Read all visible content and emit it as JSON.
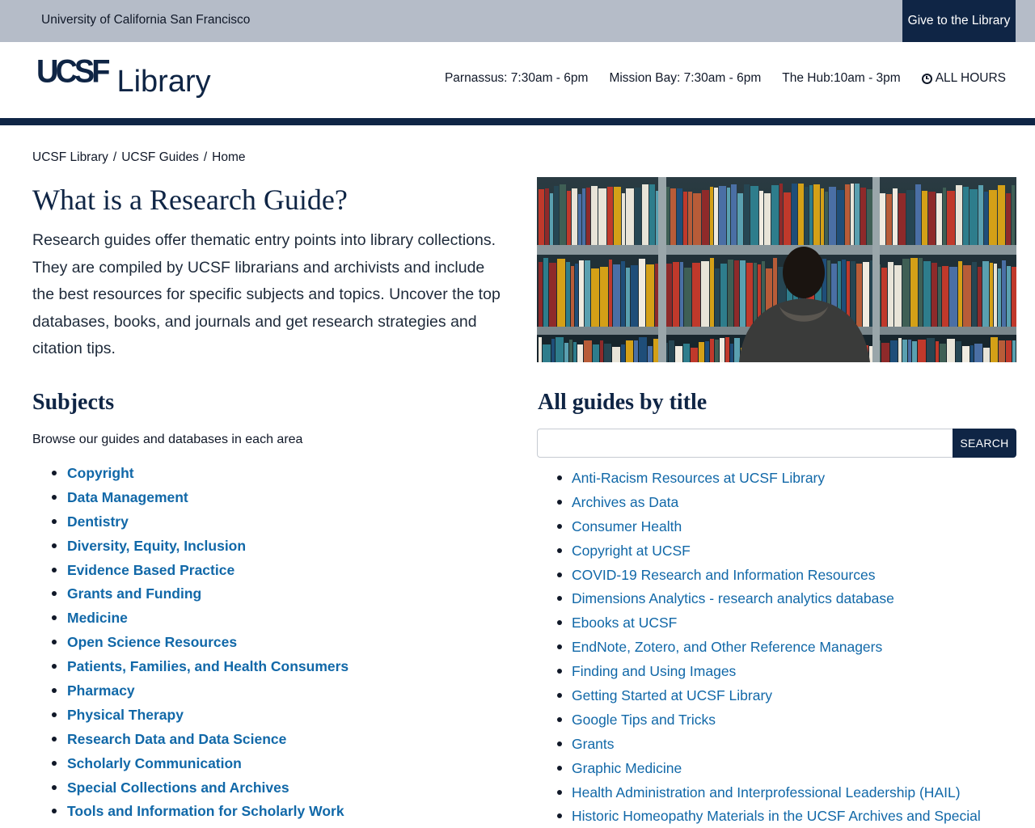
{
  "topbar": {
    "university": "University of California San Francisco",
    "give_label": "Give to the Library"
  },
  "header": {
    "logo_mark": "UCSF",
    "logo_word": "Library",
    "hours": [
      {
        "label": "Parnassus: 7:30am - 6pm"
      },
      {
        "label": "Mission Bay: 7:30am - 6pm"
      },
      {
        "label": "The Hub:10am - 3pm"
      }
    ],
    "all_hours_label": "ALL HOURS"
  },
  "breadcrumb": {
    "items": [
      "UCSF Library",
      "UCSF Guides",
      "Home"
    ],
    "separator": "/"
  },
  "intro": {
    "title": "What is a Research Guide?",
    "text": "Research guides offer thematic entry points into library collections. They are compiled by UCSF librarians and archivists and include the best resources for specific subjects and topics. Uncover the top databases, books, and journals and get research strategies and citation tips."
  },
  "subjects": {
    "title": "Subjects",
    "description": "Browse our guides and databases in each area",
    "items": [
      "Copyright",
      "Data Management",
      "Dentistry",
      "Diversity, Equity, Inclusion",
      "Evidence Based Practice",
      "Grants and Funding",
      "Medicine",
      "Open Science Resources",
      "Patients, Families, and Health Consumers",
      "Pharmacy",
      "Physical Therapy",
      "Research Data and Data Science",
      "Scholarly Communication",
      "Special Collections and Archives",
      "Tools and Information for Scholarly Work"
    ]
  },
  "guides": {
    "title": "All guides by title",
    "search_placeholder": "",
    "search_button": "SEARCH",
    "items": [
      "Anti-Racism Resources at UCSF Library",
      "Archives as Data",
      "Consumer Health",
      "Copyright at UCSF",
      "COVID-19 Research and Information Resources",
      "Dimensions Analytics - research analytics database",
      "Ebooks at UCSF",
      "EndNote, Zotero, and Other Reference Managers",
      "Finding and Using Images",
      "Getting Started at UCSF Library",
      "Google Tips and Tricks",
      "Grants",
      "Graphic Medicine",
      "Health Administration and Interprofessional Leadership (HAIL)",
      "Historic Homeopathy Materials in the UCSF Archives and Special"
    ]
  },
  "colors": {
    "navy": "#0f2545",
    "topbar_bg": "#b5bcc8",
    "link": "#1168a8"
  }
}
